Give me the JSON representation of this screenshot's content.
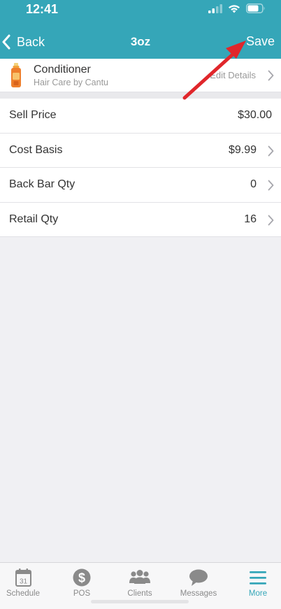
{
  "status_bar": {
    "time": "12:41"
  },
  "nav": {
    "back_label": "Back",
    "title": "3oz",
    "save_label": "Save"
  },
  "product": {
    "name": "Conditioner",
    "brand": "Hair Care by Cantu",
    "edit_label": "Edit Details"
  },
  "fields": [
    {
      "label": "Sell Price",
      "value": "$30.00"
    },
    {
      "label": "Cost Basis",
      "value": "$9.99"
    },
    {
      "label": "Back Bar Qty",
      "value": "0"
    },
    {
      "label": "Retail Qty",
      "value": "16"
    }
  ],
  "tabs": [
    {
      "label": "Schedule",
      "icon": "calendar-icon",
      "badge": "31"
    },
    {
      "label": "POS",
      "icon": "dollar-icon"
    },
    {
      "label": "Clients",
      "icon": "people-icon"
    },
    {
      "label": "Messages",
      "icon": "chat-bubble-icon"
    },
    {
      "label": "More",
      "icon": "hamburger-menu-icon",
      "active": true
    }
  ],
  "colors": {
    "accent": "#35a6b8",
    "annotation_arrow": "#e0262b",
    "tab_inactive": "#8a8a8a",
    "background": "#f0f0f3"
  }
}
